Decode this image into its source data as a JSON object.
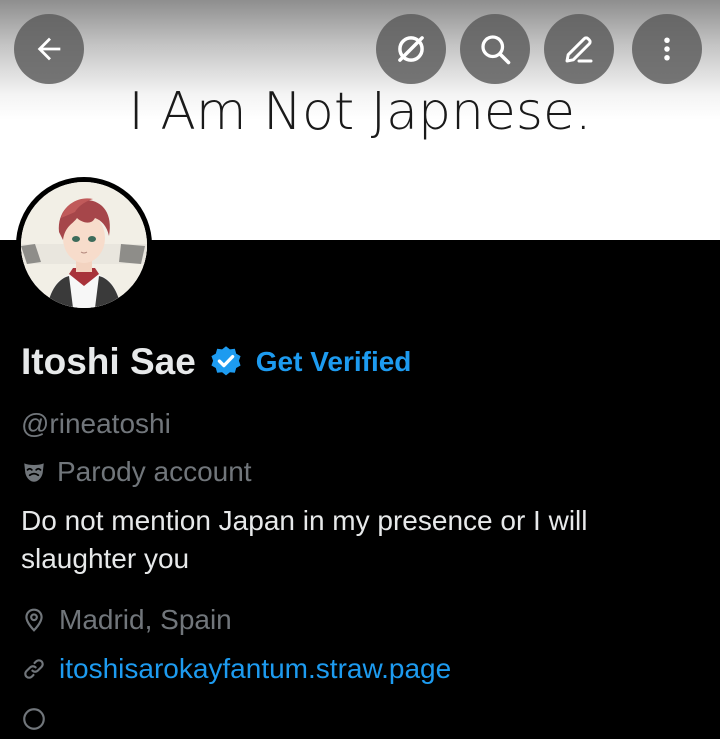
{
  "banner": {
    "text": "I Am Not Japnese."
  },
  "profile": {
    "name": "Itoshi Sae",
    "get_verified": "Get Verified",
    "handle": "@rineatoshi",
    "parody": "Parody account",
    "bio": "Do not mention Japan in my presence or I will slaughter you",
    "location": "Madrid, Spain",
    "website": "itoshisarokayfantum.straw.page"
  },
  "colors": {
    "background": "#000000",
    "text_primary": "#e7e9ea",
    "text_secondary": "#71767b",
    "accent": "#1d9bf0"
  },
  "icons": {
    "back": "arrow-left-icon",
    "grok": "grok-icon",
    "search": "search-icon",
    "edit": "pencil-icon",
    "more": "more-vertical-icon",
    "verified": "verified-badge-icon",
    "parody": "parody-mask-icon",
    "location": "location-pin-icon",
    "link": "link-icon"
  }
}
